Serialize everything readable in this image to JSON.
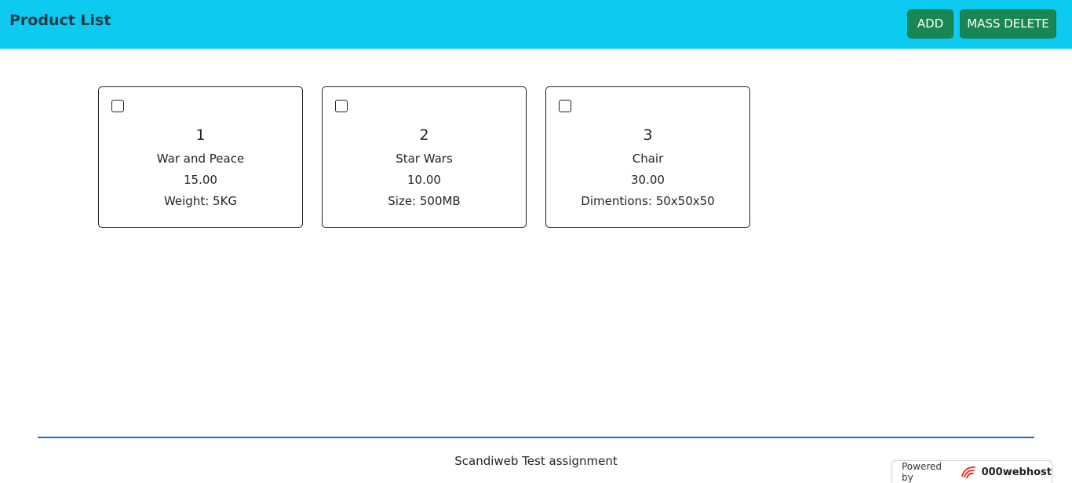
{
  "header": {
    "title": "Product List",
    "add_label": "ADD",
    "mass_delete_label": "MASS DELETE"
  },
  "products": [
    {
      "sku": "1",
      "name": "War and Peace",
      "price": "15.00",
      "attribute": "Weight: 5KG"
    },
    {
      "sku": "2",
      "name": "Star Wars",
      "price": "10.00",
      "attribute": "Size: 500MB"
    },
    {
      "sku": "3",
      "name": "Chair",
      "price": "30.00",
      "attribute": "Dimentions: 50x50x50"
    }
  ],
  "footer": {
    "text": "Scandiweb Test assignment"
  },
  "powered_by": {
    "label": "Powered by",
    "brand": "000webhost",
    "icon": "webhost-logo-icon"
  },
  "colors": {
    "header_bg": "#0dcaf0",
    "button_bg": "#198754",
    "footer_rule": "#1f6fd0"
  }
}
